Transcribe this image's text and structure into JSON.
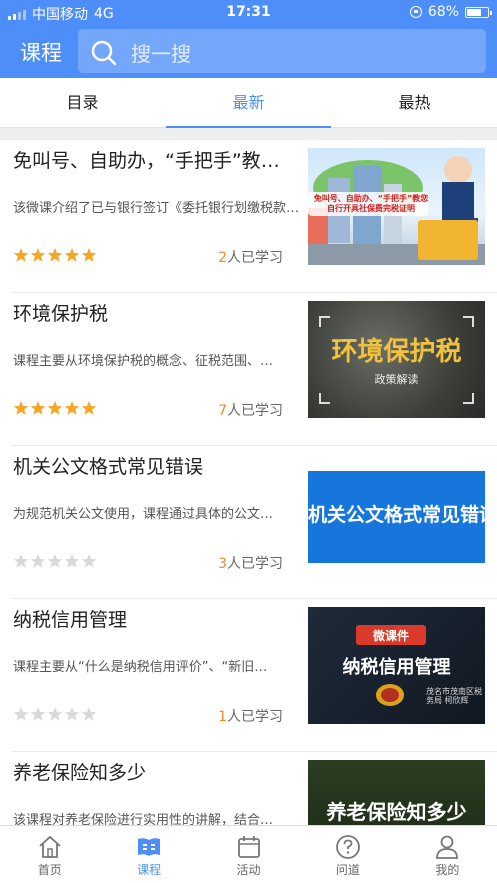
{
  "status_bar": {
    "carrier": "中国移动",
    "network": "4G",
    "time": "17:31",
    "battery": "68%",
    "battery_level": 0.68
  },
  "header": {
    "title": "课程",
    "search_placeholder": "搜一搜"
  },
  "tabs": [
    {
      "label": "目录",
      "active": false
    },
    {
      "label": "最新",
      "active": true
    },
    {
      "label": "最热",
      "active": false
    }
  ],
  "courses": [
    {
      "title": "免叫号、自助办，“手把手”教您网上申报…",
      "desc": "该微课介绍了已与银行签订《委托银行划缴税款协议》…",
      "rating": 5,
      "learners": "2",
      "learners_suffix": "人已学习",
      "thumb_caption": "免叫号、自助办、“手把手”教您自行开具社保费完税证明"
    },
    {
      "title": "环境保护税",
      "desc": "课程主要从环境保护税的概念、征税范围、…",
      "rating": 5,
      "learners": "7",
      "learners_suffix": "人已学习",
      "thumb_caption": "环境保护税",
      "thumb_subcaption": "政策解读"
    },
    {
      "title": "机关公文格式常见错误",
      "desc": "为规范机关公文使用，课程通过具体的公文…",
      "rating": 0,
      "learners": "3",
      "learners_suffix": "人已学习",
      "thumb_caption": "机关公文格式常见错误"
    },
    {
      "title": "纳税信用管理",
      "desc": "课程主要从“什么是纳税信用评价”、“新旧…",
      "rating": 0,
      "learners": "1",
      "learners_suffix": "人已学习",
      "thumb_badge": "微课件",
      "thumb_caption": "纳税信用管理",
      "thumb_subcaption": "茂名市茂南区税务局 柯欣辉"
    },
    {
      "title": "养老保险知多少",
      "desc": "该课程对养老保险进行实用性的讲解，结合…",
      "rating": 0,
      "learners": "",
      "learners_suffix": "",
      "thumb_caption": "养老保险知多少"
    }
  ],
  "bottom_nav": [
    {
      "label": "首页",
      "icon": "home-icon",
      "active": false
    },
    {
      "label": "课程",
      "icon": "course-book-icon",
      "active": true
    },
    {
      "label": "活动",
      "icon": "calendar-icon",
      "active": false
    },
    {
      "label": "问道",
      "icon": "question-icon",
      "active": false
    },
    {
      "label": "我的",
      "icon": "user-icon",
      "active": false
    }
  ],
  "colors": {
    "primary": "#4d8ef8",
    "star_on": "#f5a623",
    "star_off": "#d9d9d9",
    "count": "#f08a2a"
  }
}
